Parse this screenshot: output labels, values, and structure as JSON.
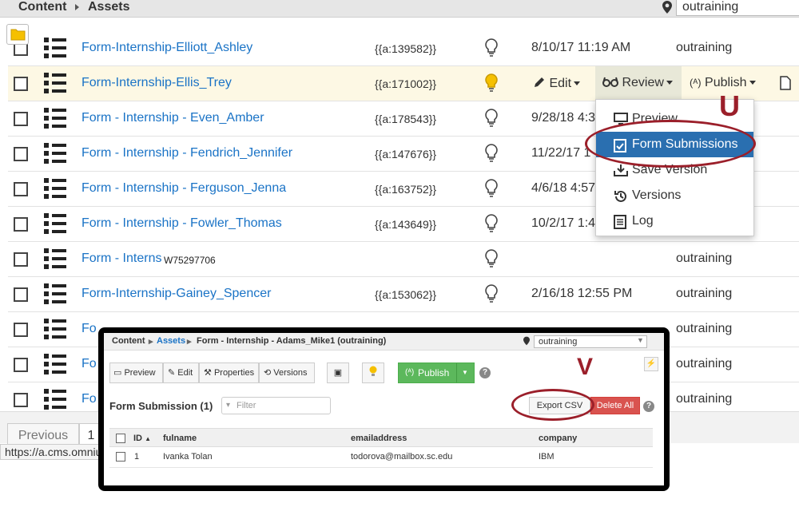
{
  "breadcrumb": {
    "content": "Content",
    "assets": "Assets"
  },
  "site_selector": {
    "value": "outraining"
  },
  "rows": [
    {
      "name": "Form-Internship-Elliott_Ashley",
      "id": "{{a:139582}}",
      "date": "8/10/17 11:19 AM",
      "site": "outraining"
    },
    {
      "name": "Form-Internship-Ellis_Trey",
      "id": "{{a:171002}}",
      "date": "",
      "site": ""
    },
    {
      "name": "Form - Internship - Even_Amber",
      "id": "{{a:178543}}",
      "date": "9/28/18 4:3",
      "site": ""
    },
    {
      "name": "Form - Internship - Fendrich_Jennifer",
      "id": "{{a:147676}}",
      "date": "11/22/17 1",
      "site": ""
    },
    {
      "name": "Form - Internship - Ferguson_Jenna",
      "id": "{{a:163752}}",
      "date": "4/6/18 4:57",
      "site": ""
    },
    {
      "name": "Form - Internship - Fowler_Thomas",
      "id": "{{a:143649}}",
      "date": "10/2/17 1:4",
      "site": ""
    },
    {
      "name": "Form - Interns",
      "overlay": "W75297706",
      "id": "",
      "date": "",
      "site": "outraining"
    },
    {
      "name": "Form-Internship-Gainey_Spencer",
      "id": "{{a:153062}}",
      "date": "2/16/18 12:55 PM",
      "site": "outraining"
    },
    {
      "name": "Fo",
      "id": "",
      "date": "",
      "site": "outraining"
    },
    {
      "name": "Fo",
      "id": "",
      "date": "",
      "site": "outraining"
    },
    {
      "name": "Fo",
      "id": "",
      "date": "",
      "site": "outraining"
    }
  ],
  "row_actions": {
    "edit": "Edit",
    "review": "Review",
    "publish": "Publish"
  },
  "review_menu": {
    "items": [
      "Preview",
      "Form Submissions",
      "Save Version",
      "Versions",
      "Log"
    ],
    "active": "Form Submissions"
  },
  "annotations": {
    "u": "U",
    "v": "V"
  },
  "pagination": {
    "previous": "Previous",
    "page": "1"
  },
  "status_url": "https://a.cms.omniu",
  "inset": {
    "breadcrumb": {
      "content": "Content",
      "assets": "Assets",
      "page": "Form - Internship - Adams_Mike1 (outraining)"
    },
    "site_selector": "outraining",
    "toolbar": {
      "preview": "Preview",
      "edit": "Edit",
      "properties": "Properties",
      "versions": "Versions",
      "publish": "Publish"
    },
    "form_submission_title": "Form Submission (1)",
    "filter_placeholder": "Filter",
    "export_csv": "Export CSV",
    "delete_all": "Delete All",
    "table": {
      "headers": [
        "ID",
        "fulname",
        "emailaddress",
        "company"
      ],
      "rows": [
        [
          "1",
          "Ivanka Tolan",
          "todorova@mailbox.sc.edu",
          "IBM"
        ]
      ]
    }
  },
  "colors": {
    "link": "#1a73c6",
    "annotation": "#9b1f2a",
    "menu_active": "#2a6fb0",
    "publish": "#5cb85c",
    "delete": "#d9534f"
  }
}
